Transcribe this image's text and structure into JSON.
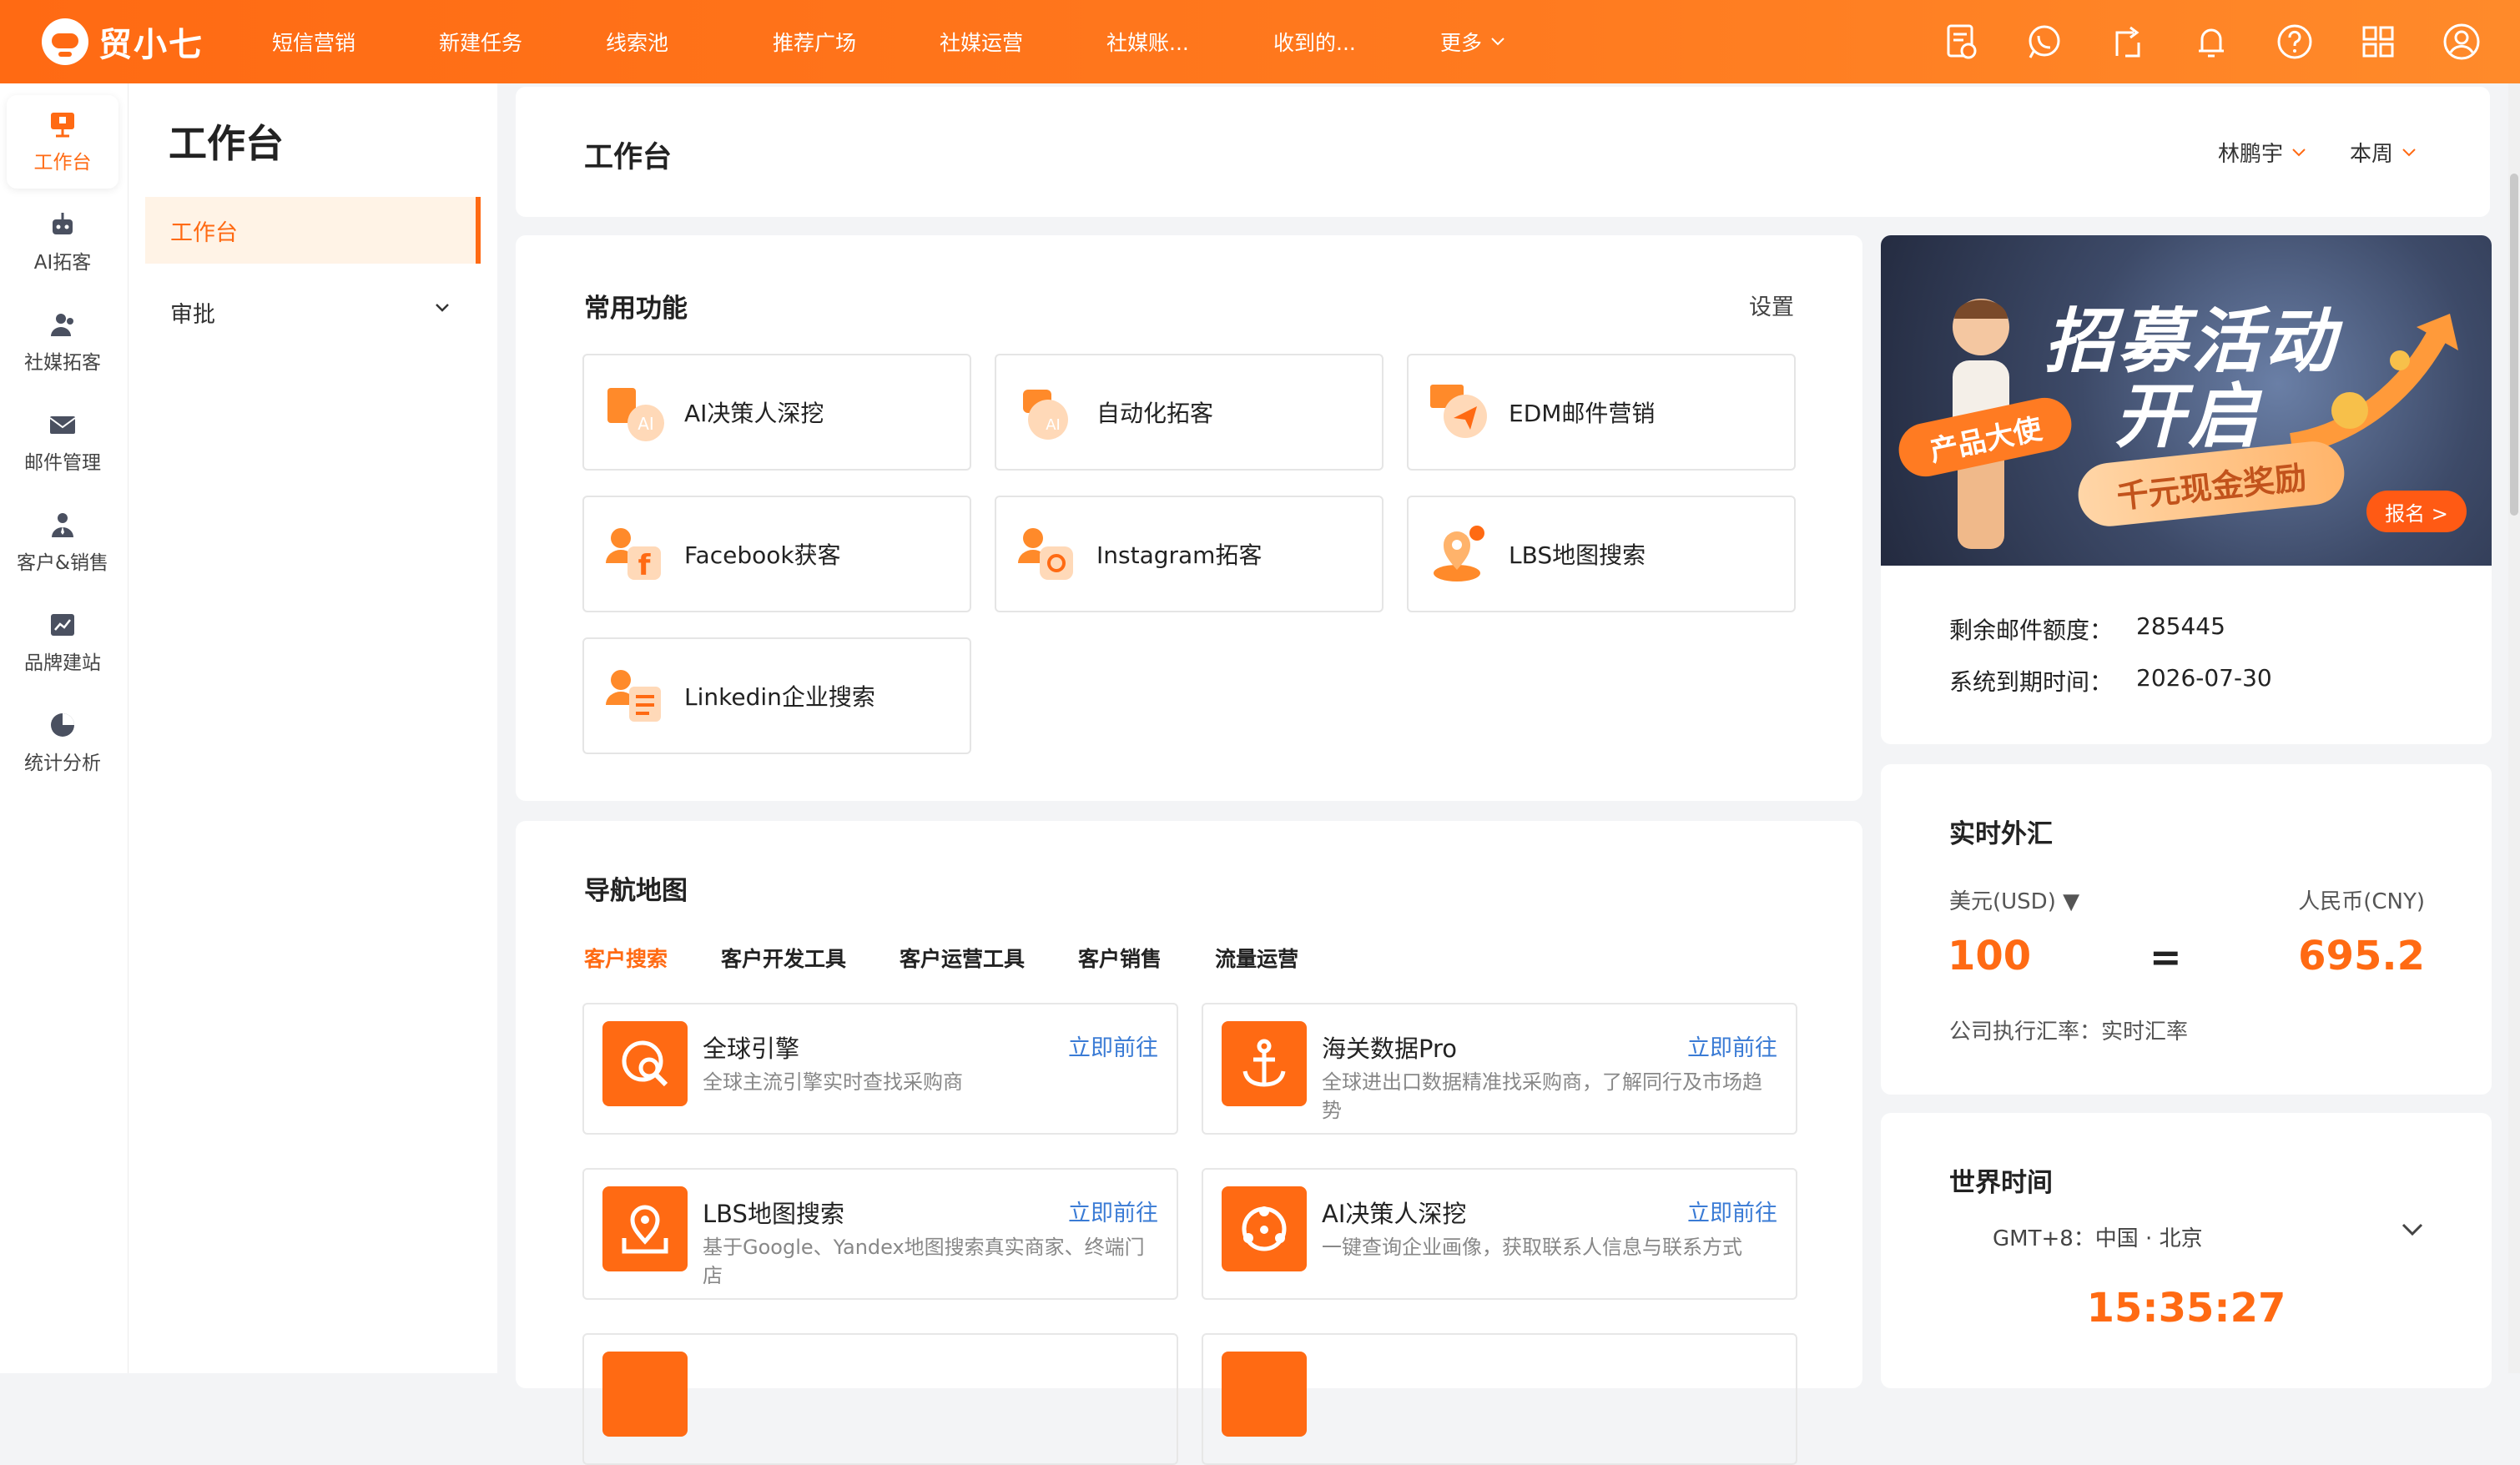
{
  "app": {
    "name": "贸小七"
  },
  "topnav": {
    "items": [
      "短信营销",
      "新建任务",
      "线索池",
      "推荐广场",
      "社媒运营",
      "社媒账...",
      "收到的...",
      "更多"
    ]
  },
  "topicons": [
    "form-icon",
    "whatsapp-icon",
    "share-icon",
    "bell-icon",
    "help-icon",
    "apps-icon",
    "avatar"
  ],
  "rail": {
    "items": [
      {
        "label": "工作台",
        "icon": "workbench-icon"
      },
      {
        "label": "AI拓客",
        "icon": "robot-icon"
      },
      {
        "label": "社媒拓客",
        "icon": "users-icon"
      },
      {
        "label": "邮件管理",
        "icon": "mail-icon"
      },
      {
        "label": "客户&销售",
        "icon": "customer-icon"
      },
      {
        "label": "品牌建站",
        "icon": "chart-icon"
      },
      {
        "label": "统计分析",
        "icon": "pie-icon"
      }
    ]
  },
  "subnav": {
    "title": "工作台",
    "items": [
      "工作台",
      "审批"
    ]
  },
  "header": {
    "title": "工作台",
    "user_filter": "林鹏宇",
    "period_filter": "本周"
  },
  "common": {
    "title": "常用功能",
    "settings": "设置",
    "functions": [
      "AI决策人深挖",
      "自动化拓客",
      "EDM邮件营销",
      "Facebook获客",
      "Instagram拓客",
      "LBS地图搜索",
      "Linkedin企业搜索"
    ]
  },
  "navmap": {
    "title": "导航地图",
    "tabs": [
      "客户搜索",
      "客户开发工具",
      "客户运营工具",
      "客户销售",
      "流量运营"
    ],
    "go_label": "立即前往",
    "tools": [
      {
        "name": "全球引擎",
        "desc": "全球主流引擎实时查找采购商"
      },
      {
        "name": "海关数据Pro",
        "desc": "全球进出口数据精准找采购商，了解同行及市场趋势"
      },
      {
        "name": "LBS地图搜索",
        "desc": "基于Google、Yandex地图搜索真实商家、终端门店"
      },
      {
        "name": "AI决策人深挖",
        "desc": "一键查询企业画像，获取联系人信息与联系方式"
      }
    ]
  },
  "banner": {
    "line1": "招募活动",
    "line2": "开启",
    "tag": "产品大使",
    "pill": "千元现金奖励",
    "button": "报名 >"
  },
  "quota": {
    "mail_label": "剩余邮件额度：",
    "mail_value": "285445",
    "expire_label": "系统到期时间：",
    "expire_value": "2026-07-30"
  },
  "fx": {
    "title": "实时外汇",
    "from_currency": "美元(USD) ▼",
    "to_currency": "人民币(CNY)",
    "from_amount": "100",
    "equals": "=",
    "to_amount": "695.2",
    "note": "公司执行汇率：实时汇率"
  },
  "worldtime": {
    "title": "世界时间",
    "zone": "GMT+8：中国 · 北京",
    "time": "15:35:27"
  },
  "colors": {
    "brand": "#ff6a13",
    "link": "#3a7bd5"
  }
}
